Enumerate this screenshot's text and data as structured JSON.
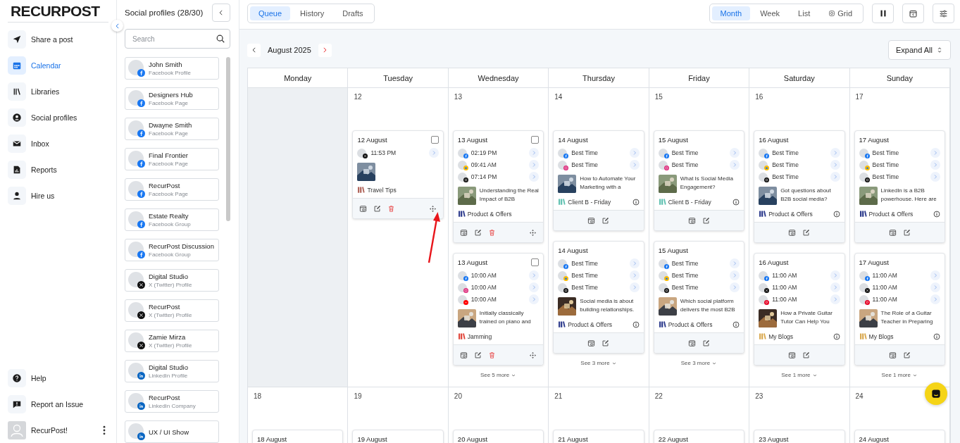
{
  "logo": {
    "text": "RECURPOST"
  },
  "nav": {
    "items": [
      {
        "kind": "send",
        "label": "Share a post",
        "selected": false
      },
      {
        "kind": "calendar",
        "label": "Calendar",
        "selected": true
      },
      {
        "kind": "library",
        "label": "Libraries",
        "selected": false
      },
      {
        "kind": "profile",
        "label": "Social profiles",
        "selected": false
      },
      {
        "kind": "inbox",
        "label": "Inbox",
        "selected": false
      },
      {
        "kind": "reports",
        "label": "Reports",
        "selected": false
      },
      {
        "kind": "person",
        "label": "Hire us",
        "selected": false
      }
    ],
    "bottom": [
      {
        "kind": "help",
        "label": "Help"
      },
      {
        "kind": "report",
        "label": "Report an Issue"
      }
    ],
    "user": {
      "name": "RecurPost!"
    }
  },
  "profiles": {
    "title": "Social profiles (28/30)",
    "search": {
      "placeholder": "Search"
    },
    "items": [
      {
        "name": "John Smith",
        "type": "Facebook Profile",
        "kind": "facebook"
      },
      {
        "name": "Designers Hub",
        "type": "Facebook Page",
        "kind": "facebook"
      },
      {
        "name": "Dwayne Smith",
        "type": "Facebook Page",
        "kind": "facebook"
      },
      {
        "name": "Final Frontier",
        "type": "Facebook Page",
        "kind": "facebook"
      },
      {
        "name": "RecurPost",
        "type": "Facebook Page",
        "kind": "facebook"
      },
      {
        "name": "Estate Realty",
        "type": "Facebook Group",
        "kind": "facebook"
      },
      {
        "name": "RecurPost Discussion",
        "type": "Facebook Group",
        "kind": "facebook"
      },
      {
        "name": "Digital Studio",
        "type": "X (Twitter) Profile",
        "kind": "x"
      },
      {
        "name": "RecurPost",
        "type": "X (Twitter) Profile",
        "kind": "x"
      },
      {
        "name": "Zamie Mirza",
        "type": "X (Twitter) Profile",
        "kind": "x"
      },
      {
        "name": "Digital Studio",
        "type": "LinkedIn Profile",
        "kind": "linkedin"
      },
      {
        "name": "RecurPost",
        "type": "LinkedIn Company",
        "kind": "linkedin"
      },
      {
        "name": "UX / UI Show",
        "kind": "linkedin"
      }
    ]
  },
  "tabs": [
    {
      "label": "Queue",
      "selected": true
    },
    {
      "label": "History",
      "selected": false
    },
    {
      "label": "Drafts",
      "selected": false
    }
  ],
  "views": [
    {
      "label": "Month",
      "selected": true,
      "kind": "text"
    },
    {
      "label": "Week",
      "selected": false,
      "kind": "text"
    },
    {
      "label": "List",
      "selected": false,
      "kind": "text"
    },
    {
      "label": "Grid",
      "selected": false,
      "kind": "icon"
    }
  ],
  "calendar": {
    "month": "August 2025",
    "expand": "Expand All",
    "weekdays": [
      "Monday",
      "Tuesday",
      "Wednesday",
      "Thursday",
      "Friday",
      "Saturday",
      "Sunday"
    ],
    "weeks": [
      {
        "days": [
          {
            "kind": "outside"
          },
          {
            "kind": "day",
            "date": "12",
            "posts": [
              {
                "title": "12 August",
                "checked": false,
                "slots": [
                  {
                    "kind": "x",
                    "time": "11:53 PM"
                  }
                ],
                "library": {
                  "name": "Travel Tips",
                  "color": "#b0645a"
                },
                "delete": true,
                "move": true
              }
            ]
          },
          {
            "kind": "day",
            "date": "13",
            "more": "See 5 more",
            "posts": [
              {
                "title": "13 August",
                "checked": false,
                "slots": [
                  {
                    "kind": "facebook",
                    "time": "02:19 PM"
                  },
                  {
                    "kind": "google-business",
                    "time": "09:41 AM"
                  },
                  {
                    "kind": "threads",
                    "time": "07:14 PM"
                  }
                ],
                "text": "Understanding the Real Impact of B2B",
                "library": {
                  "name": "Product & Offers",
                  "color": "#2c3a8c"
                },
                "delete": true,
                "move": true
              },
              {
                "title": "13 August",
                "checked": false,
                "slots": [
                  {
                    "kind": "facebook",
                    "time": "10:00 AM"
                  },
                  {
                    "kind": "instagram",
                    "time": "10:00 AM"
                  },
                  {
                    "kind": "youtube",
                    "time": "10:00 AM"
                  }
                ],
                "text": "Initially classically trained on piano and",
                "library": {
                  "name": "Jamming",
                  "color": "#e0453a"
                },
                "delete": true,
                "move": true
              }
            ]
          },
          {
            "kind": "day",
            "date": "14",
            "more": "See 3 more",
            "posts": [
              {
                "title": "14 August",
                "slots": [
                  {
                    "kind": "facebook",
                    "time": "Best Time"
                  },
                  {
                    "kind": "instagram",
                    "time": "Best Time"
                  }
                ],
                "text": "How to Automate Your Marketing with a",
                "library": {
                  "name": "Client B - Friday",
                  "color": "#5fc0b0"
                },
                "info": true
              },
              {
                "title": "14 August",
                "slots": [
                  {
                    "kind": "facebook",
                    "time": "Best Time"
                  },
                  {
                    "kind": "google-business",
                    "time": "Best Time"
                  },
                  {
                    "kind": "threads",
                    "time": "Best Time"
                  }
                ],
                "text": "Social media is about building relationships.",
                "library": {
                  "name": "Product & Offers",
                  "color": "#2c3a8c"
                },
                "info": true
              }
            ]
          },
          {
            "kind": "day",
            "date": "15",
            "more": "See 3 more",
            "posts": [
              {
                "title": "15 August",
                "slots": [
                  {
                    "kind": "facebook",
                    "time": "Best Time"
                  },
                  {
                    "kind": "instagram",
                    "time": "Best Time"
                  }
                ],
                "text": "What Is Social Media Engagement?",
                "library": {
                  "name": "Client B - Friday",
                  "color": "#5fc0b0"
                },
                "info": true
              },
              {
                "title": "15 August",
                "slots": [
                  {
                    "kind": "facebook",
                    "time": "Best Time"
                  },
                  {
                    "kind": "google-business",
                    "time": "Best Time"
                  },
                  {
                    "kind": "threads",
                    "time": "Best Time"
                  }
                ],
                "text": "Which social platform delivers the most B2B",
                "library": {
                  "name": "Product & Offers",
                  "color": "#2c3a8c"
                },
                "info": true
              }
            ]
          },
          {
            "kind": "day",
            "date": "16",
            "more": "See 1 more",
            "posts": [
              {
                "title": "16 August",
                "slots": [
                  {
                    "kind": "facebook",
                    "time": "Best Time"
                  },
                  {
                    "kind": "google-business",
                    "time": "Best Time"
                  },
                  {
                    "kind": "threads",
                    "time": "Best Time"
                  }
                ],
                "text": "Got questions about B2B social media?",
                "library": {
                  "name": "Product & Offers",
                  "color": "#2c3a8c"
                },
                "info": true
              },
              {
                "title": "16 August",
                "slots": [
                  {
                    "kind": "facebook",
                    "time": "11:00 AM"
                  },
                  {
                    "kind": "x",
                    "time": "11:00 AM"
                  },
                  {
                    "kind": "pinterest",
                    "time": "11:00 AM"
                  }
                ],
                "text": "How a Private Guitar Tutor Can Help You",
                "library": {
                  "name": "My Blogs",
                  "color": "#d9a94f"
                },
                "info": true
              }
            ]
          },
          {
            "kind": "day",
            "date": "17",
            "more": "See 1 more",
            "posts": [
              {
                "title": "17 August",
                "slots": [
                  {
                    "kind": "facebook",
                    "time": "Best Time"
                  },
                  {
                    "kind": "google-business",
                    "time": "Best Time"
                  },
                  {
                    "kind": "threads",
                    "time": "Best Time"
                  }
                ],
                "text": "LinkedIn is a B2B powerhouse. Here are",
                "library": {
                  "name": "Product & Offers",
                  "color": "#2c3a8c"
                },
                "info": true
              },
              {
                "title": "17 August",
                "slots": [
                  {
                    "kind": "facebook",
                    "time": "11:00 AM"
                  },
                  {
                    "kind": "x",
                    "time": "11:00 AM"
                  },
                  {
                    "kind": "pinterest",
                    "time": "11:00 AM"
                  }
                ],
                "text": "The Role of a Guitar Teacher in Preparing",
                "library": {
                  "name": "My Blogs",
                  "color": "#d9a94f"
                },
                "info": true
              }
            ]
          }
        ]
      },
      {
        "days": [
          {
            "kind": "day",
            "date": "18",
            "posts": [
              {
                "title": "18 August"
              }
            ]
          },
          {
            "kind": "day",
            "date": "19",
            "posts": [
              {
                "title": "19 August"
              }
            ]
          },
          {
            "kind": "day",
            "date": "20",
            "posts": [
              {
                "title": "20 August"
              }
            ]
          },
          {
            "kind": "day",
            "date": "21",
            "posts": [
              {
                "title": "21 August"
              }
            ]
          },
          {
            "kind": "day",
            "date": "22",
            "posts": [
              {
                "title": "22 August"
              }
            ]
          },
          {
            "kind": "day",
            "date": "23",
            "posts": [
              {
                "title": "23 August"
              }
            ]
          },
          {
            "kind": "day",
            "date": "24",
            "posts": [
              {
                "title": "24 August"
              }
            ]
          }
        ]
      }
    ]
  }
}
